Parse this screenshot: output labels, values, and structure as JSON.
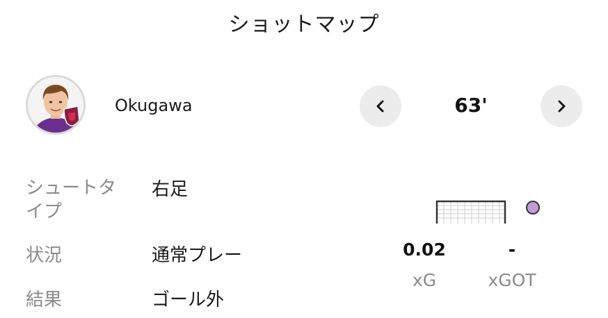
{
  "title": "ショットマップ",
  "player": {
    "name": "Okugawa"
  },
  "navigation": {
    "prev_icon": "chevron-left-icon",
    "next_icon": "chevron-right-icon",
    "minute": "63'"
  },
  "details": [
    {
      "label": "シュートタイプ",
      "value": "右足"
    },
    {
      "label": "状況",
      "value": "通常プレー"
    },
    {
      "label": "結果",
      "value": "ゴール外"
    }
  ],
  "shot_marker_color": "#c49bd0",
  "stats": {
    "xg_value": "0.02",
    "xg_label": "xG",
    "xgot_value": "-",
    "xgot_label": "xGOT"
  }
}
